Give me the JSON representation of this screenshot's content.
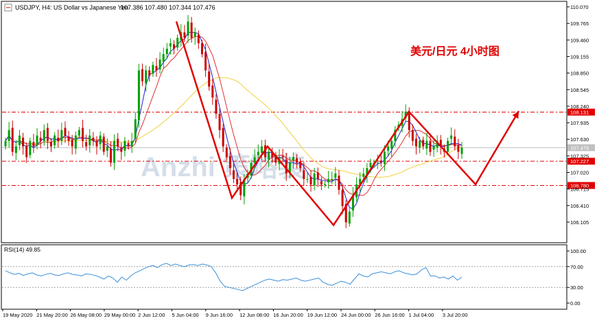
{
  "header": {
    "symbol_line": "USDJPY, H4: US Dollar vs Japanese Yen",
    "ohlc": "107.386 107.480 107.344 107.476"
  },
  "annotation": "美元/日元  4小时图",
  "watermark": "Anzhi 策略装",
  "rsi_label": "RSI(14) 49.85",
  "colors": {
    "bull_candle": "#00a000",
    "bear_candle": "#cc0000",
    "ma_blue": "#2020d0",
    "ma_red": "#e03030",
    "ma_yellow": "#f0d040",
    "rsi_line": "#3a8fd8",
    "arrow": "#e00000",
    "level_line": "#e00000"
  },
  "chart_data": [
    {
      "type": "candlestick",
      "title": "USDJPY, H4: US Dollar vs Japanese Yen",
      "ylim": [
        105.9,
        110.1
      ],
      "y_ticks": [
        110.07,
        109.765,
        109.46,
        109.155,
        108.85,
        108.545,
        108.24,
        107.935,
        107.63,
        107.325,
        107.02,
        106.715,
        106.41,
        106.105
      ],
      "x_tick_labels": [
        "19 May 2020",
        "21 May 20:00",
        "26 May 08:00",
        "29 May 00:00",
        "2 Jun 12:00",
        "5 Jun 04:00",
        "9 Jun 16:00",
        "12 Jun 08:00",
        "16 Jun 20:00",
        "19 Jun 12:00",
        "24 Jun 00:00",
        "26 Jun 16:00",
        "1 Jul 04:00",
        "3 Jul 20:00"
      ],
      "price_levels": [
        {
          "value": 108.131,
          "label": "108.131"
        },
        {
          "value": 107.227,
          "label": "107.227"
        },
        {
          "value": 106.78,
          "label": "106.780"
        }
      ],
      "current_price": {
        "value": 107.476,
        "label": "107.476"
      },
      "path_points": [
        {
          "x": "5 Jun 04:00",
          "y": 109.8
        },
        {
          "x": "11 Jun",
          "y": 106.55
        },
        {
          "x": "15 Jun",
          "y": 107.5
        },
        {
          "x": "22 Jun",
          "y": 106.05
        },
        {
          "x": "30 Jun",
          "y": 108.14
        },
        {
          "x": "7 Jul",
          "y": 106.8
        },
        {
          "x": "10 Jul",
          "y": 108.15
        }
      ],
      "close_series": [
        107.6,
        107.8,
        107.4,
        107.5,
        107.7,
        107.5,
        107.3,
        107.6,
        107.5,
        107.7,
        107.6,
        107.8,
        107.6,
        107.5,
        107.7,
        107.6,
        107.8,
        107.7,
        107.6,
        107.5,
        107.7,
        107.8,
        107.6,
        107.5,
        107.7,
        107.6,
        107.5,
        107.7,
        107.4,
        107.5,
        107.2,
        107.6,
        107.5,
        107.4,
        107.6,
        107.5,
        107.6,
        108.0,
        108.9,
        108.7,
        108.9,
        108.8,
        109.0,
        108.9,
        109.1,
        109.2,
        109.3,
        109.4,
        109.3,
        109.5,
        109.6,
        109.5,
        109.8,
        109.5,
        109.6,
        109.4,
        109.2,
        108.9,
        108.6,
        108.4,
        108.1,
        107.8,
        107.5,
        107.3,
        107.1,
        106.9,
        106.8,
        106.6,
        106.9,
        107.0,
        107.2,
        107.3,
        107.4,
        107.5,
        107.3,
        107.4,
        107.3,
        107.2,
        107.3,
        107.3,
        107.0,
        107.2,
        107.3,
        107.2,
        107.1,
        106.9,
        106.9,
        106.8,
        107.0,
        106.9,
        106.8,
        106.8,
        106.9,
        106.9,
        107.0,
        106.7,
        106.4,
        106.1,
        106.3,
        106.6,
        106.8,
        106.9,
        107.0,
        107.1,
        107.2,
        107.2,
        107.2,
        107.2,
        107.4,
        107.5,
        107.6,
        107.8,
        107.9,
        108.0,
        108.14,
        107.8,
        107.6,
        107.5,
        107.6,
        107.5,
        107.6,
        107.4,
        107.5,
        107.6,
        107.5,
        107.4,
        107.6,
        107.7,
        107.5,
        107.4,
        107.476
      ]
    },
    {
      "type": "line",
      "title": "RSI(14) 49.85",
      "ylim": [
        0,
        100
      ],
      "y_ticks": [
        100.0,
        70.0,
        30.0,
        0.0
      ],
      "reference_lines": [
        70,
        30
      ],
      "values": [
        62,
        58,
        55,
        57,
        53,
        56,
        58,
        54,
        52,
        55,
        57,
        54,
        53,
        56,
        58,
        55,
        54,
        52,
        56,
        55,
        53,
        50,
        46,
        52,
        48,
        40,
        50,
        44,
        52,
        58,
        62,
        66,
        70,
        72,
        68,
        74,
        76,
        72,
        75,
        72,
        70,
        73,
        74,
        72,
        75,
        73,
        70,
        58,
        42,
        32,
        30,
        28,
        26,
        24,
        28,
        32,
        36,
        40,
        44,
        46,
        44,
        42,
        45,
        44,
        46,
        48,
        44,
        42,
        44,
        46,
        48,
        40,
        36,
        34,
        38,
        42,
        40,
        36,
        46,
        56,
        52,
        50,
        56,
        58,
        60,
        58,
        56,
        60,
        62,
        58,
        56,
        54,
        56,
        64,
        68,
        52,
        52,
        48,
        50,
        46,
        52,
        44,
        50
      ]
    }
  ]
}
